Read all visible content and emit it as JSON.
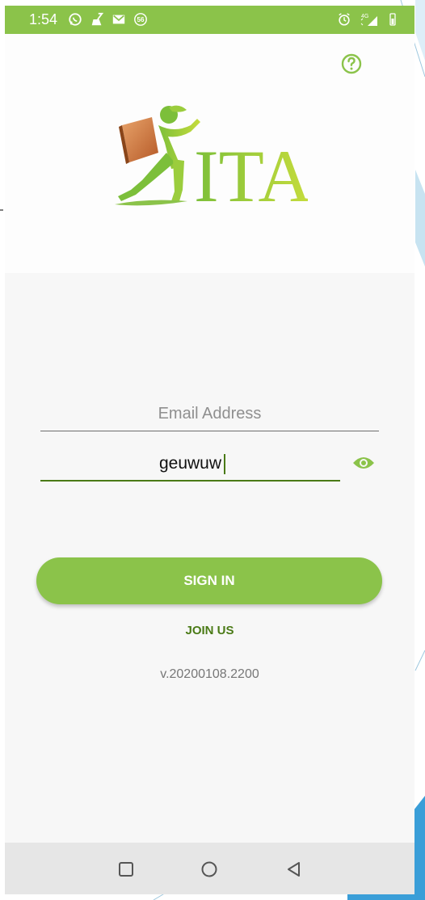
{
  "status_bar": {
    "time": "1:54",
    "notification_badge": "56",
    "network_label": "4G",
    "icons_left": [
      "whatsapp-icon",
      "cleaner-icon",
      "gmail-icon",
      "badge-56-icon"
    ],
    "icons_right": [
      "alarm-icon",
      "signal-icon",
      "battery-icon"
    ]
  },
  "header": {
    "help_icon": "question-circle-icon",
    "logo_text": "ITA"
  },
  "login_form": {
    "email_placeholder": "Email Address",
    "email_value": "",
    "password_value": "geuwuw",
    "show_password_icon": "eye-icon"
  },
  "actions": {
    "sign_in_label": "SIGN IN",
    "join_label": "JOIN US"
  },
  "footer": {
    "version": "v.20200108.2200"
  },
  "nav_bar": {
    "buttons": [
      "recent-apps-icon",
      "home-icon",
      "back-icon"
    ]
  },
  "colors": {
    "accent": "#8bc34a",
    "accent_dark": "#4a7a16",
    "background": "#f7f7f7",
    "nav_bar": "#e6e6e6"
  }
}
